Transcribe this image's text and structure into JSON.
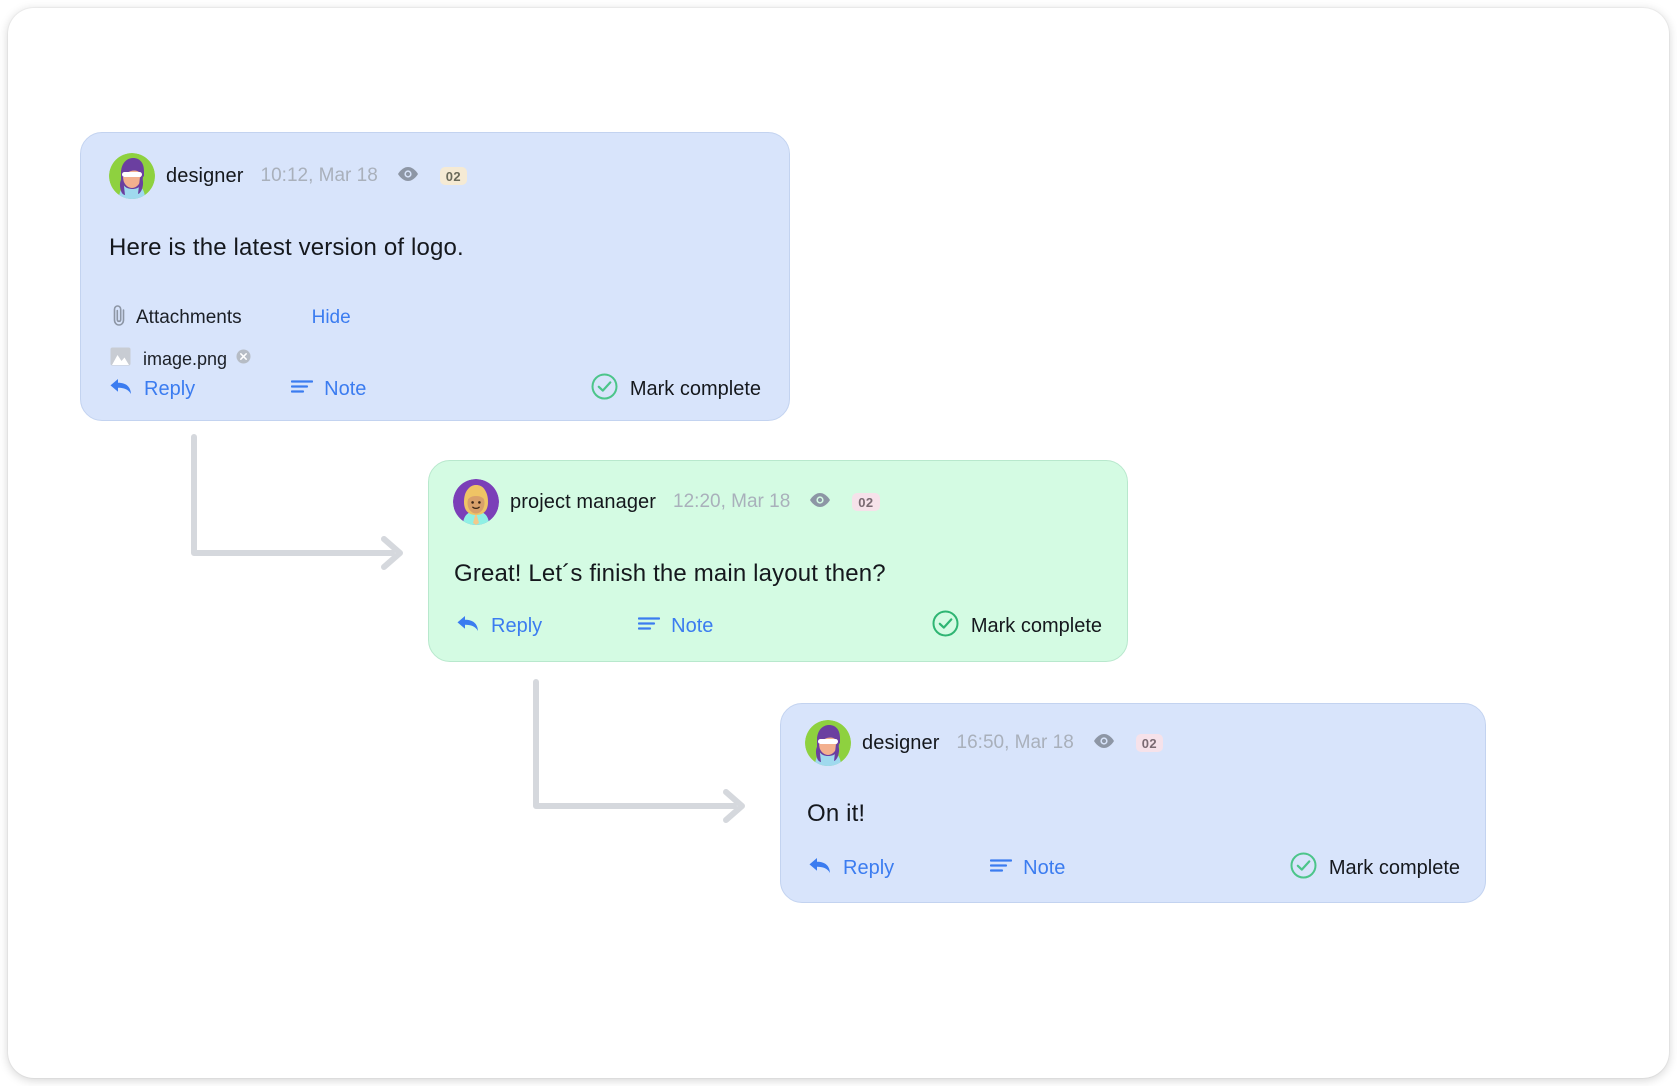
{
  "thread": {
    "messages": [
      {
        "id": "msg-1",
        "author": "designer",
        "timestamp": "10:12, Mar 18",
        "view_count": "02",
        "body": "Here is the latest version of logo.",
        "color": "blue",
        "attachments": {
          "label": "Attachments",
          "toggle_label": "Hide",
          "files": [
            {
              "name": "image.png"
            }
          ]
        },
        "actions": {
          "reply": "Reply",
          "note": "Note",
          "complete": "Mark complete"
        }
      },
      {
        "id": "msg-2",
        "author": "project manager",
        "timestamp": "12:20, Mar 18",
        "view_count": "02",
        "body": "Great! Let´s finish the main layout then?",
        "color": "green",
        "actions": {
          "reply": "Reply",
          "note": "Note",
          "complete": "Mark complete"
        }
      },
      {
        "id": "msg-3",
        "author": "designer",
        "timestamp": "16:50, Mar 18",
        "view_count": "02",
        "body": "On it!",
        "color": "blue",
        "actions": {
          "reply": "Reply",
          "note": "Note",
          "complete": "Mark complete"
        }
      }
    ]
  },
  "icons": {
    "eye": "eye-icon",
    "paperclip": "paperclip-icon",
    "image_thumb": "image-thumbnail-icon",
    "remove": "remove-icon",
    "reply": "reply-arrow-icon",
    "note": "note-lines-icon",
    "check_circle": "check-circle-icon",
    "connector_arrow": "connector-arrow-icon"
  },
  "colors": {
    "card_blue": "#d8e4fb",
    "card_green": "#d4fbe3",
    "link_blue": "#3b7cf0",
    "check_green": "#4cc58a",
    "timestamp_gray": "#a9b0bb",
    "connector_gray": "#d5d8dd",
    "badge_cream": "#f5ead4",
    "badge_pink": "#f6e2ea"
  }
}
